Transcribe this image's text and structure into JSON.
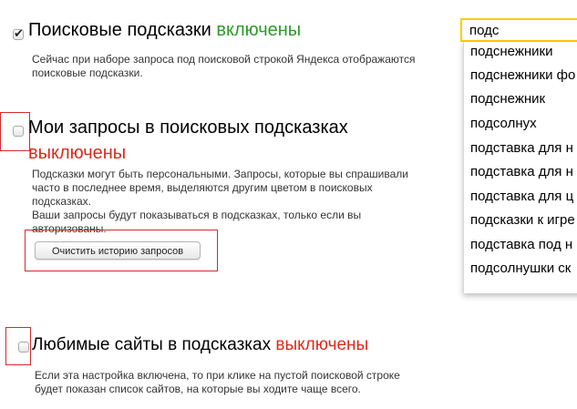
{
  "section_suggestions": {
    "title_prefix": "Поисковые подсказки",
    "status": "включены",
    "checked_mark": "✔",
    "desc_line1": "Сейчас при наборе запроса под поисковой строкой Яндекса отображаются",
    "desc_line2": "поисковые подсказки."
  },
  "section_my_queries": {
    "title_line1": "Мои запросы в поисковых подсказках",
    "status": "выключены",
    "desc_line1": "Подсказки могут быть персональными. Запросы, которые вы спрашивали",
    "desc_line2": "часто в последнее время, выделяются другим цветом в поисковых",
    "desc_line3": "подсказках.",
    "desc_line4": "Ваши запросы будут показываться в подсказках, только если вы",
    "desc_line5": "авторизованы.",
    "clear_button": "Очистить историю запросов"
  },
  "section_favorites": {
    "title_prefix": "Любимые сайты в подсказках",
    "status": "выключены",
    "desc_line1": "Если эта настройка включена, то при клике на пустой поисковой строке",
    "desc_line2": "будет показан список сайтов, на которые вы ходите чаще всего."
  },
  "search": {
    "value": "подс",
    "suggestions": [
      "подснежники",
      "подснежники фо",
      "подснежник",
      "подсолнух",
      "подставка для н",
      "подставка для н",
      "подставка для ц",
      "подсказки к игре",
      "подставка под н",
      "подсолнушки ск"
    ]
  },
  "colors": {
    "enabled": "#2b9b27",
    "disabled": "#e0291c",
    "highlight_box": "#d42a2a",
    "search_border": "#ffcc00"
  }
}
